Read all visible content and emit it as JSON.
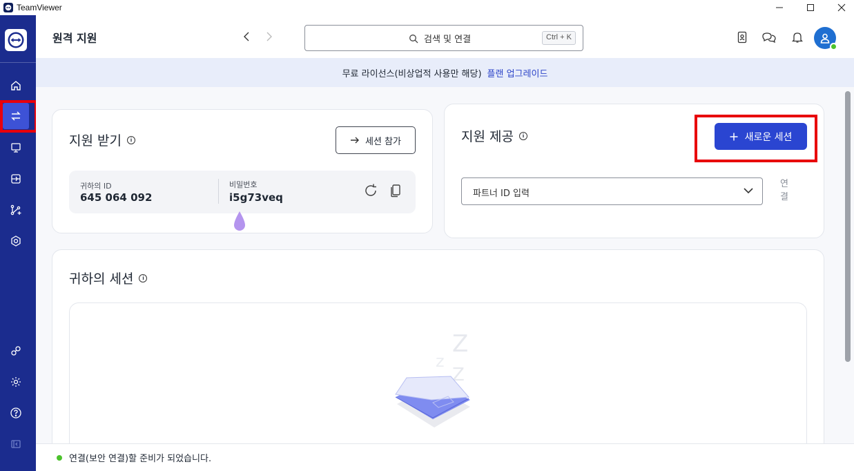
{
  "window": {
    "title": "TeamViewer"
  },
  "header": {
    "title": "원격 지원",
    "search": {
      "placeholder": "검색 및 연결",
      "shortcut": "Ctrl + K"
    }
  },
  "banner": {
    "text": "무료 라이선스(비상업적 사용만 해당)",
    "link": "플랜 업그레이드"
  },
  "receive": {
    "title": "지원 받기",
    "join_button": "세션 참가",
    "id_label": "귀하의 ID",
    "id_value": "645 064 092",
    "password_label": "비밀번호",
    "password_value": "i5g73veq"
  },
  "provide": {
    "title": "지원 제공",
    "new_session_button": "새로운 세션",
    "partner_placeholder": "파트너 ID 입력",
    "connect_label": "연결"
  },
  "sessions": {
    "title": "귀하의 세션"
  },
  "status": {
    "text": "연결(보안 연결)할 준비가 되었습니다."
  },
  "colors": {
    "sidebar": "#1b2c8e",
    "primary": "#2a45d1",
    "highlight": "#e8000b",
    "online": "#4cc22c"
  },
  "icons": [
    "home-icon",
    "remote-support-icon",
    "remote-access-icon",
    "meeting-icon",
    "flow-icon",
    "security-icon",
    "keys-icon",
    "settings-icon",
    "help-icon",
    "collapse-icon",
    "contacts-icon",
    "chat-icon",
    "bell-icon",
    "user-icon"
  ]
}
